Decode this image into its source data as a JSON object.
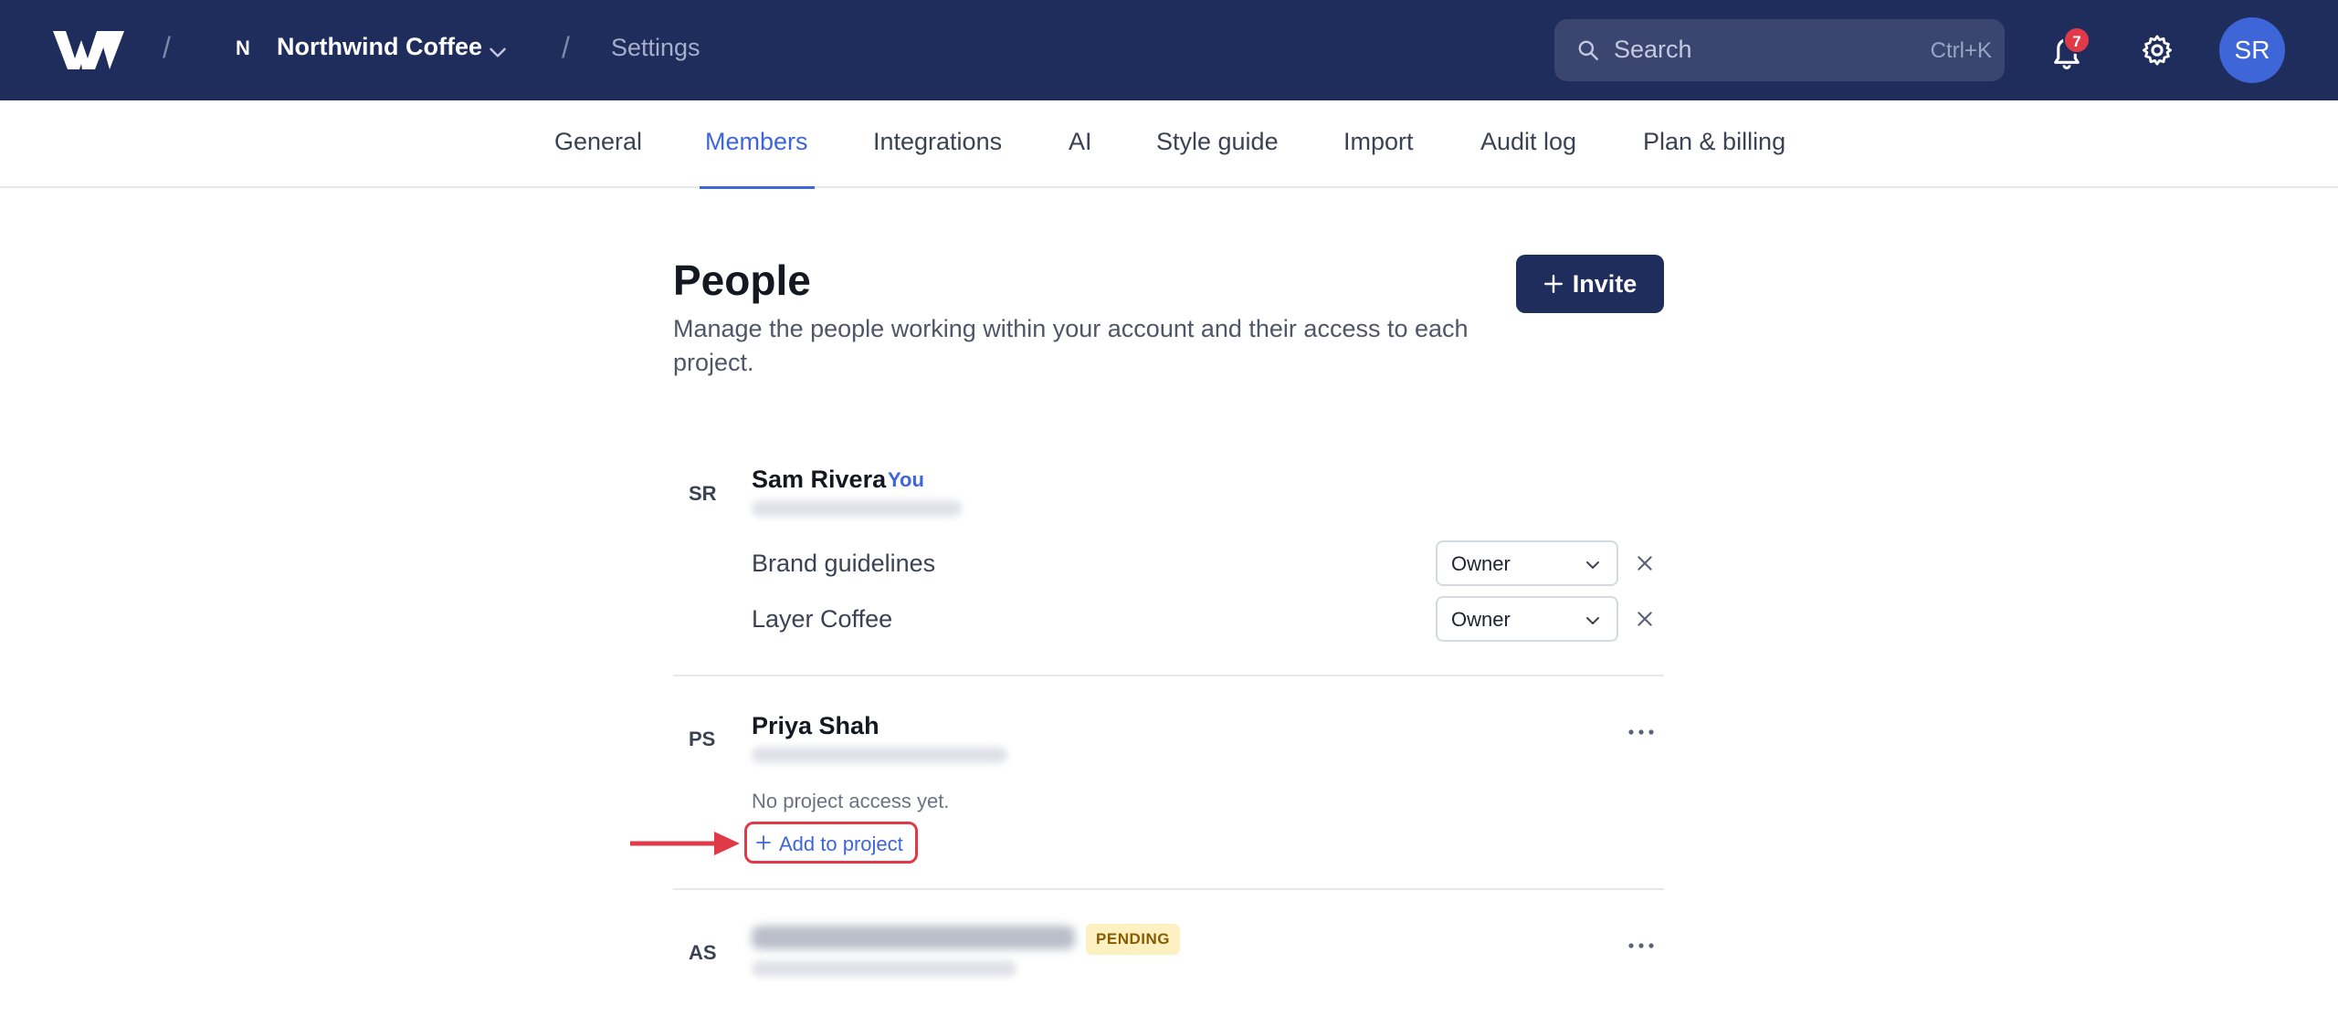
{
  "header": {
    "logo_icon": "w-logo-icon",
    "separator": "/",
    "workspace_initial": "N",
    "workspace_name": "Northwind Coffee",
    "breadcrumb_current": "Settings",
    "search": {
      "placeholder": "Search",
      "shortcut": "Ctrl+K"
    },
    "notifications_count": "7",
    "user_initials": "SR"
  },
  "tabs": [
    {
      "label": "General"
    },
    {
      "label": "Members",
      "active": true
    },
    {
      "label": "Integrations"
    },
    {
      "label": "AI"
    },
    {
      "label": "Style guide"
    },
    {
      "label": "Import"
    },
    {
      "label": "Audit log"
    },
    {
      "label": "Plan & billing"
    }
  ],
  "page": {
    "title": "People",
    "description": "Manage the people working within your account and their access to each project.",
    "invite_label": "Invite"
  },
  "members": [
    {
      "initials": "SR",
      "name": "Sam Rivera",
      "tag": "You",
      "projects": [
        {
          "name": "Brand guidelines",
          "role": "Owner"
        },
        {
          "name": "Layer Coffee",
          "role": "Owner"
        }
      ]
    },
    {
      "initials": "PS",
      "name": "Priya Shah",
      "no_access_text": "No project access yet.",
      "add_project_label": "Add to project"
    },
    {
      "initials": "AS",
      "status_badge": "PENDING"
    }
  ],
  "colors": {
    "header_bg": "#1f2d5c",
    "accent": "#3e66d8",
    "highlight": "#e03a49",
    "pending_bg": "#fdf1c2"
  }
}
